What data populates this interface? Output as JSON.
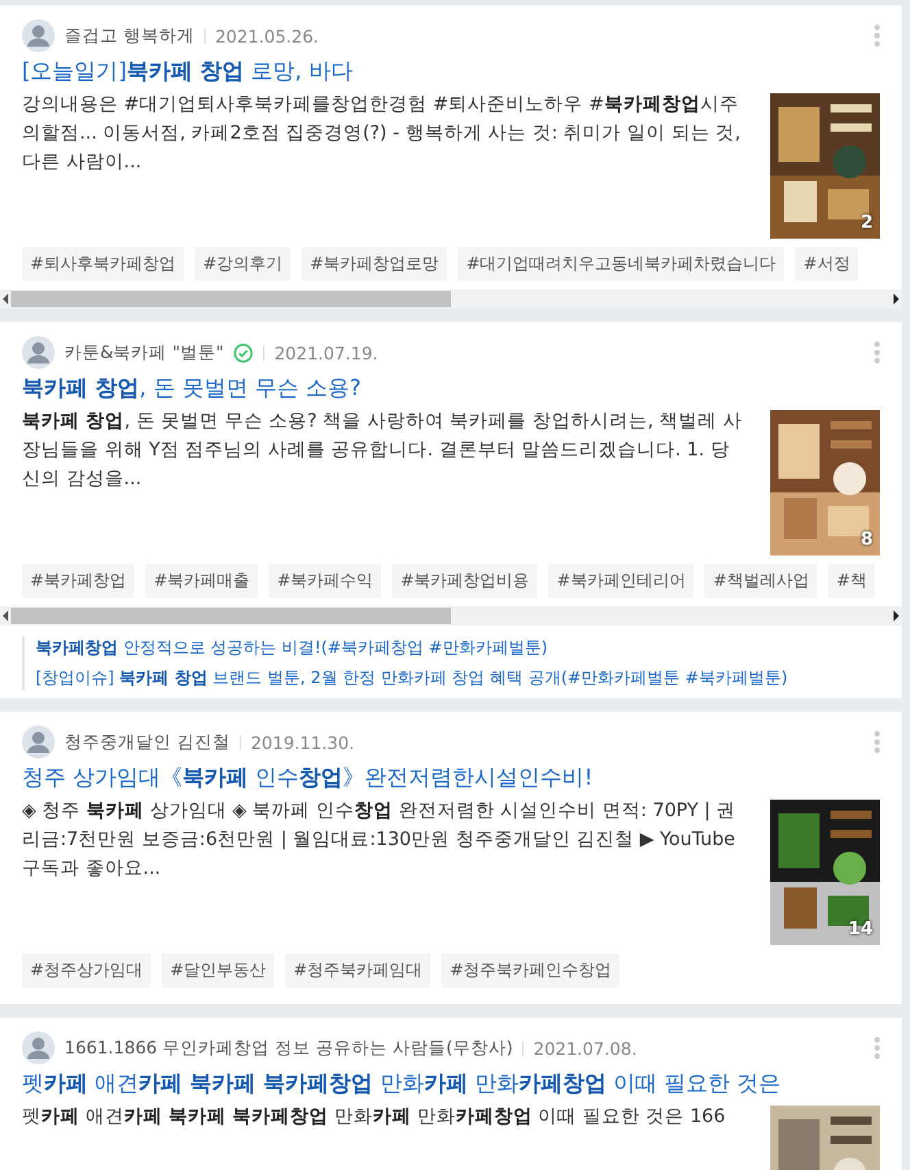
{
  "posts": [
    {
      "author": "즐겁고 행복하게",
      "verified": false,
      "date": "2021.05.26.",
      "title": "[오늘일기]**북카페 창업** 로망, 바다",
      "description": "강의내용은 #대기업퇴사후북카페를창업한경험 #퇴사준비노하우 #**북카페창업**시주의할점... 이동서점, 카페2호점 집중경영(?) - 행복하게 사는 것: 취미가 일이 되는 것, 다른 사람이...",
      "image_count": "2",
      "tags": [
        "#퇴사후북카페창업",
        "#강의후기",
        "#북카페창업로망",
        "#대기업때려치우고동네북카페차렸습니다",
        "#서정"
      ],
      "tags_scrollable": true
    },
    {
      "author": "카툰&북카페 \"벌툰\"",
      "verified": true,
      "date": "2021.07.19.",
      "title": "**북카페 창업**, 돈 못벌면 무슨 소용?",
      "description": "**북카페 창업**, 돈 못벌면 무슨 소용? 책을 사랑하여 북카페를 창업하시려는, 책벌레 사장님들을 위해 Y점 점주님의 사례를 공유합니다. 결론부터 말씀드리겠습니다. 1. 당신의 감성을...",
      "image_count": "8",
      "tags": [
        "#북카페창업",
        "#북카페매출",
        "#북카페수익",
        "#북카페창업비용",
        "#북카페인테리어",
        "#책벌레사업",
        "#책"
      ],
      "tags_scrollable": true,
      "related": [
        "**북카페창업** 안정적으로 성공하는 비결!(#북카페창업 #만화카페벌툰)",
        "[창업이슈] **북카페 창업** 브랜드 벌툰, 2월 한정 만화카페 창업 혜택 공개(#만화카페벌툰 #북카페벌툰)"
      ]
    },
    {
      "author": "청주중개달인 김진철",
      "verified": false,
      "date": "2019.11.30.",
      "title": "청주 상가임대《**북카페** 인수**창업**》완전저렴한시설인수비!",
      "description": "◈ 청주 **북카페** 상가임대 ◈ 북까페 인수**창업** 완전저렴한 시설인수비 면적: 70PY | 권리금:7천만원 보증금:6천만원 | 월임대료:130만원 청주중개달인 김진철 ▶ YouTube 구독과 좋아요...",
      "image_count": "14",
      "tags": [
        "#청주상가임대",
        "#달인부동산",
        "#청주북카페임대",
        "#청주북카페인수창업"
      ],
      "tags_scrollable": false
    },
    {
      "author": "1661.1866 무인카페창업 정보 공유하는 사람들(무창사)",
      "verified": false,
      "date": "2021.07.08.",
      "title": "펫**카페** 애견**카페 북카페 북카페창업** 만화**카페** 만화**카페창업** 이때 필요한 것은",
      "description": "펫**카페** 애견**카페 북카페 북카페창업** 만화**카페** 만화**카페창업** 이때 필요한 것은 166"
    }
  ]
}
